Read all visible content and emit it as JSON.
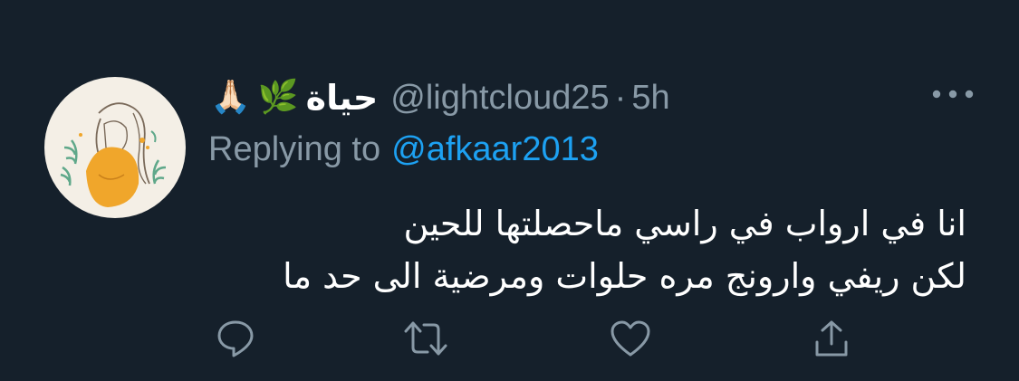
{
  "tweet": {
    "display_name": "حياة",
    "emojis": [
      "🌿",
      "🙏🏻"
    ],
    "handle": "@lightcloud25",
    "separator": "·",
    "time": "5h",
    "replying_prefix": "Replying to",
    "replying_to": "@afkaar2013",
    "text_lines": [
      "انا في ارواب في راسي ماحصلتها للحين",
      "لكن ريفي وارونج مره حلوات ومرضية الى  حد ما"
    ]
  },
  "icons": {
    "more": "more-horizontal-icon",
    "reply": "reply-icon",
    "retweet": "retweet-icon",
    "like": "heart-icon",
    "share": "share-icon"
  },
  "colors": {
    "background": "#15202b",
    "secondary_text": "#8899a6",
    "link": "#1da1f2",
    "avatar_bg": "#f4efe6",
    "avatar_accent": "#f0a62b"
  }
}
